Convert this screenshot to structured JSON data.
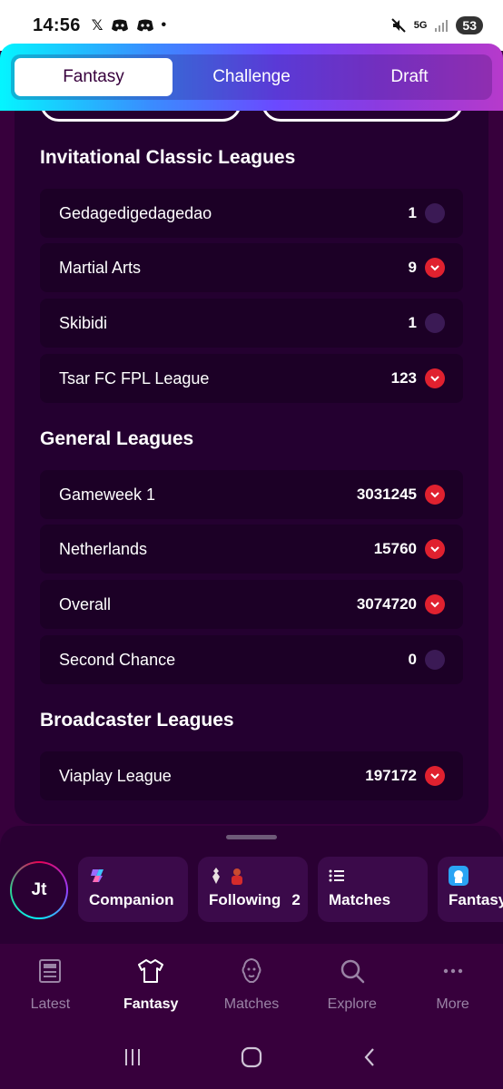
{
  "status_bar": {
    "time": "14:56",
    "left_icons": [
      "x-icon",
      "discord-icon",
      "discord-icon",
      "dot-icon"
    ],
    "right_icons": [
      "mute-icon",
      "5g-icon",
      "signal-icon"
    ],
    "network": "5G",
    "battery": "53"
  },
  "segmented": {
    "tabs": [
      {
        "label": "Fantasy",
        "active": true
      },
      {
        "label": "Challenge",
        "active": false
      },
      {
        "label": "Draft",
        "active": false
      }
    ]
  },
  "sections": [
    {
      "title": "Invitational Classic Leagues",
      "leagues": [
        {
          "name": "Gedagedigedagedao",
          "rank": "1",
          "movement": "same"
        },
        {
          "name": "Martial Arts",
          "rank": "9",
          "movement": "down"
        },
        {
          "name": "Skibidi",
          "rank": "1",
          "movement": "same"
        },
        {
          "name": "Tsar FC FPL League",
          "rank": "123",
          "movement": "down"
        }
      ]
    },
    {
      "title": "General Leagues",
      "leagues": [
        {
          "name": "Gameweek 1",
          "rank": "3031245",
          "movement": "down"
        },
        {
          "name": "Netherlands",
          "rank": "15760",
          "movement": "down"
        },
        {
          "name": "Overall",
          "rank": "3074720",
          "movement": "down"
        },
        {
          "name": "Second Chance",
          "rank": "0",
          "movement": "same"
        }
      ]
    },
    {
      "title": "Broadcaster Leagues",
      "leagues": [
        {
          "name": "Viaplay League",
          "rank": "197172",
          "movement": "down"
        }
      ]
    }
  ],
  "bottom_sheet": {
    "avatar_initials": "Jt",
    "chips": [
      {
        "label": "Companion",
        "icon": "copilot-icon"
      },
      {
        "label": "Following",
        "count": "2",
        "icon": "club-badges-icon"
      },
      {
        "label": "Matches",
        "icon": "list-icon"
      },
      {
        "label": "Fantasy",
        "icon": "premier-league-icon"
      }
    ]
  },
  "nav": {
    "items": [
      {
        "label": "Latest",
        "icon": "news-icon",
        "active": false
      },
      {
        "label": "Fantasy",
        "icon": "shirt-icon",
        "active": true
      },
      {
        "label": "Matches",
        "icon": "lion-icon",
        "active": false
      },
      {
        "label": "Explore",
        "icon": "search-icon",
        "active": false
      },
      {
        "label": "More",
        "icon": "more-icon",
        "active": false
      }
    ]
  },
  "colors": {
    "brand_purple": "#37003c",
    "rank_down": "#e0212f",
    "rank_same": "#3b1a55"
  }
}
